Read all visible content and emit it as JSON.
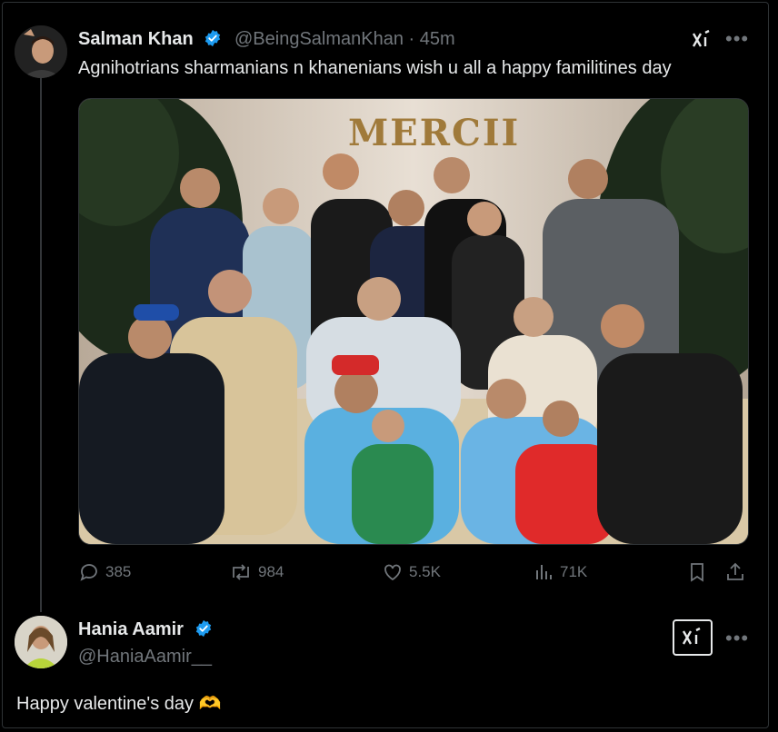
{
  "tweet": {
    "author_name": "Salman Khan",
    "author_handle": "@BeingSalmanKhan",
    "separator": "·",
    "time": "45m",
    "text": "Agnihotrians sharmanians n khanenians wish u all a happy familitines day",
    "media": {
      "sign_text": "MERCII"
    },
    "stats": {
      "replies": "385",
      "reposts": "984",
      "likes": "5.5K",
      "views": "71K"
    }
  },
  "reply": {
    "author_name": "Hania Aamir",
    "author_handle": "@HaniaAamir__",
    "text": "Happy valentine's day",
    "emoji": "🫶"
  },
  "icons": {
    "grok": "xi-icon",
    "more": "more-icon"
  },
  "colors": {
    "verified": "#1d9bf0",
    "muted": "#71767b",
    "text": "#e7e9ea"
  }
}
